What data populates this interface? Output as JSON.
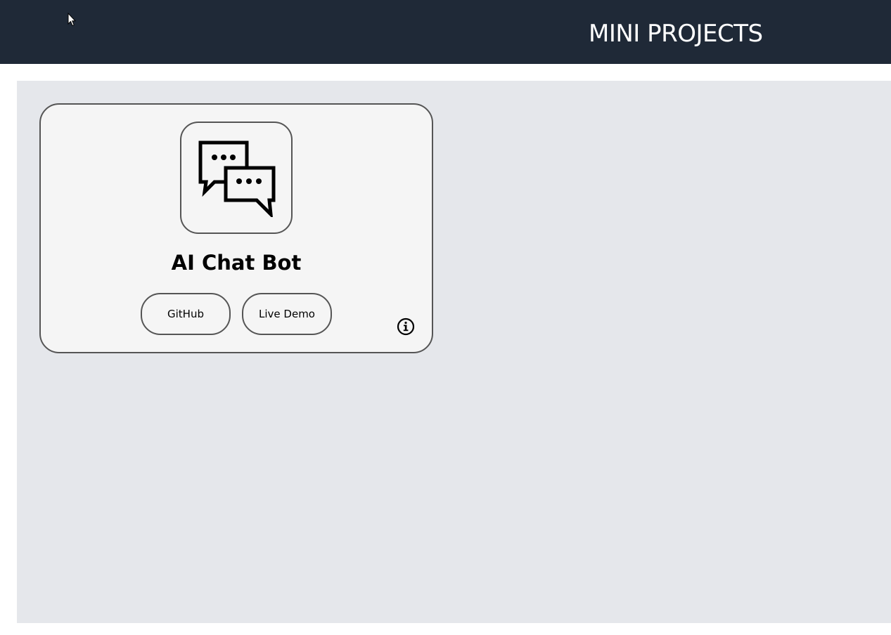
{
  "header": {
    "title": "MINI PROJECTS",
    "background": "#1f2937"
  },
  "projects": [
    {
      "title": "AI Chat Bot",
      "icon": "chat-bubbles-icon",
      "github_label": "GitHub",
      "demo_label": "Live Demo",
      "info_icon": "info-icon"
    }
  ],
  "colors": {
    "content_background": "#e5e7eb",
    "card_background": "#f5f5f5",
    "border": "#555555"
  }
}
